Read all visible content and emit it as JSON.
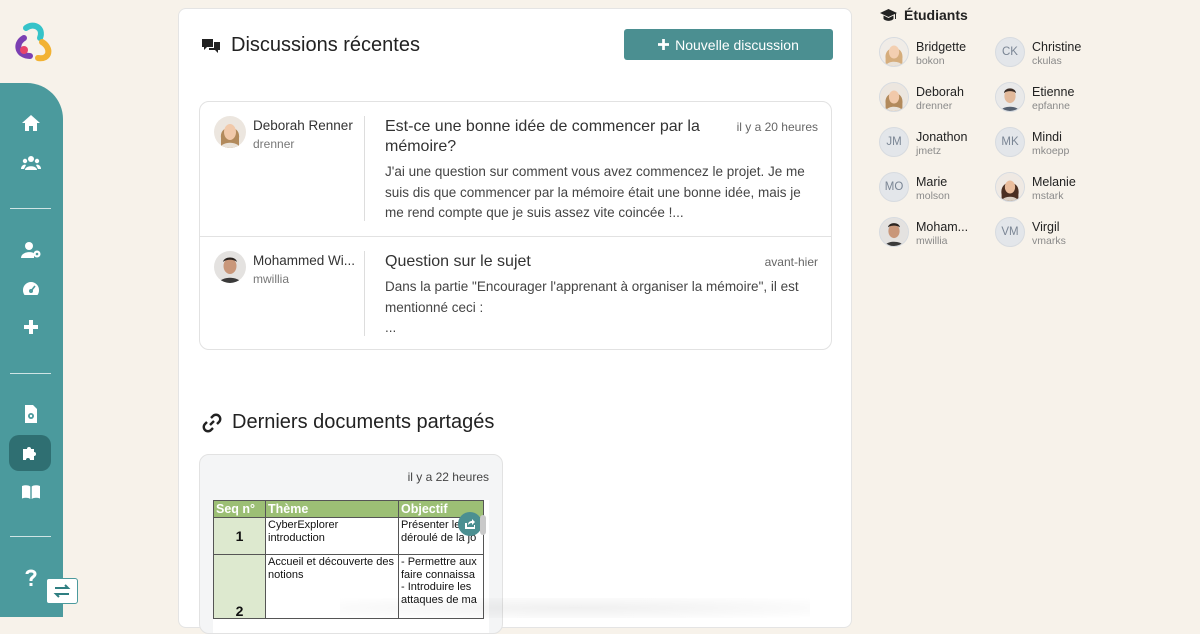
{
  "colors": {
    "accent": "#4b9a9d",
    "button": "#4b8f91",
    "background": "#f7f2ea",
    "sidebar_active": "#2f6f72",
    "table_header": "#9cbf75"
  },
  "sidebar": {
    "items": [
      {
        "icon": "home-icon"
      },
      {
        "icon": "users-icon"
      },
      {
        "icon": "user-settings-icon"
      },
      {
        "icon": "dashboard-icon"
      },
      {
        "icon": "plus-icon"
      },
      {
        "icon": "file-settings-icon"
      },
      {
        "icon": "puzzle-icon",
        "active": true
      },
      {
        "icon": "book-icon"
      },
      {
        "icon": "help-icon"
      }
    ],
    "switch_icon": "switch-arrows-icon"
  },
  "discussions": {
    "title": "Discussions récentes",
    "new_button_label": "Nouvelle discussion",
    "items": [
      {
        "author": "Deborah Renner",
        "handle": "drenner",
        "title": "Est-ce une bonne idée de commencer par la mémoire?",
        "time": "il y a 20 heures",
        "body_lines": [
          "J'ai une question sur comment vous avez commencez le projet. Je me",
          "suis dis que commencer par la mémoire était une bonne idée, mais je",
          "me rend compte que je suis assez vite coincée !..."
        ]
      },
      {
        "author": "Mohammed Wi...",
        "handle": "mwillia",
        "title": "Question sur le sujet",
        "time": "avant-hier",
        "body_lines": [
          "Dans la partie \"Encourager l'apprenant à organiser la mémoire\", il est",
          "mentionné ceci :",
          "..."
        ]
      }
    ]
  },
  "documents": {
    "title": "Derniers documents partagés",
    "items": [
      {
        "time": "il y a 22 heures",
        "preview": {
          "headers": [
            "Seq n°",
            "Thème",
            "Objectif"
          ],
          "rows": [
            {
              "seq": "1",
              "theme": [
                "CyberExplorer",
                "introduction"
              ],
              "objectif": [
                "Présenter le",
                "déroulé de la jo"
              ]
            },
            {
              "seq": "2",
              "theme": [
                "Accueil et découverte des",
                "notions"
              ],
              "objectif": [
                "- Permettre aux",
                "faire connaissa",
                "- Introduire les",
                "attaques de ma"
              ]
            }
          ]
        }
      }
    ]
  },
  "students": {
    "title": "Étudiants",
    "items": [
      {
        "name": "Bridgette",
        "handle": "bokon",
        "photo": true
      },
      {
        "name": "Christine",
        "handle": "ckulas",
        "initials": "CK"
      },
      {
        "name": "Deborah",
        "handle": "drenner",
        "photo": true
      },
      {
        "name": "Etienne",
        "handle": "epfanne",
        "photo": true
      },
      {
        "name": "Jonathon",
        "handle": "jmetz",
        "initials": "JM"
      },
      {
        "name": "Mindi",
        "handle": "mkoepp",
        "initials": "MK"
      },
      {
        "name": "Marie",
        "handle": "molson",
        "initials": "MO"
      },
      {
        "name": "Melanie",
        "handle": "mstark",
        "photo": true
      },
      {
        "name": "Moham...",
        "handle": "mwillia",
        "photo": true
      },
      {
        "name": "Virgil",
        "handle": "vmarks",
        "initials": "VM"
      }
    ]
  }
}
